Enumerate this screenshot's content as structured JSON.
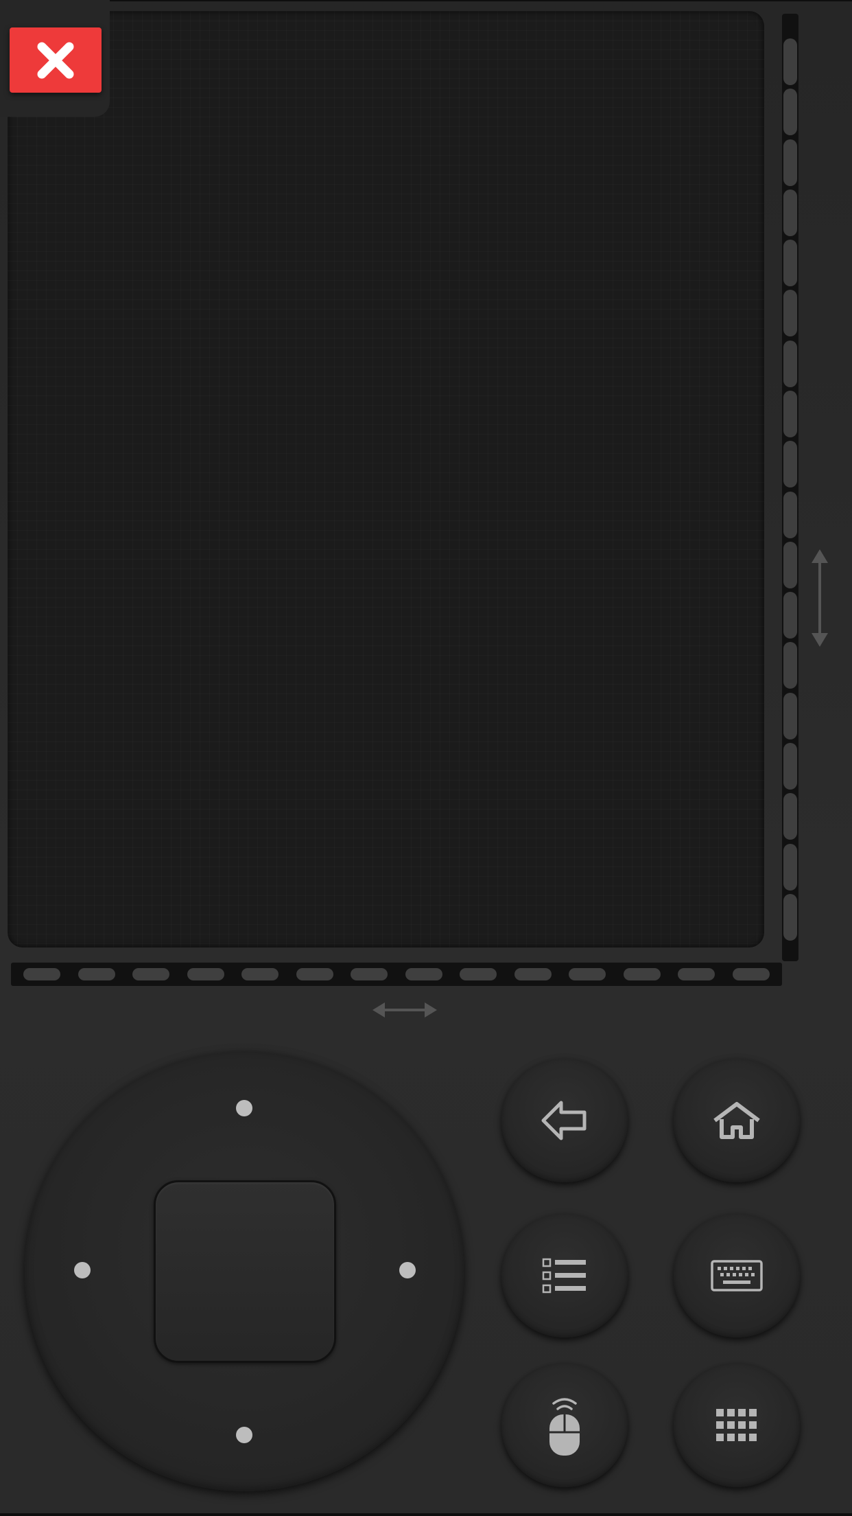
{
  "window": {
    "title": ""
  },
  "touchpad": {
    "label": ""
  },
  "close_button": {
    "icon": "close-icon",
    "color": "#ee3a3a"
  },
  "scroll": {
    "vertical_icon": "vertical-scroll-arrow-icon",
    "horizontal_icon": "horizontal-scroll-arrow-icon"
  },
  "dpad": {
    "directions": [
      "up",
      "down",
      "left",
      "right"
    ],
    "center_icon": ""
  },
  "buttons": [
    {
      "name": "back",
      "icon": "back-arrow-icon"
    },
    {
      "name": "home",
      "icon": "home-icon"
    },
    {
      "name": "menu",
      "icon": "list-menu-icon"
    },
    {
      "name": "keyboard",
      "icon": "keyboard-icon"
    },
    {
      "name": "mouse",
      "icon": "air-mouse-icon"
    },
    {
      "name": "apps",
      "icon": "app-grid-icon"
    }
  ],
  "colors": {
    "background": "#2a2a2a",
    "touchpad": "#1b1b1b",
    "accent": "#ee3a3a",
    "icon": "#b5b5b5"
  }
}
